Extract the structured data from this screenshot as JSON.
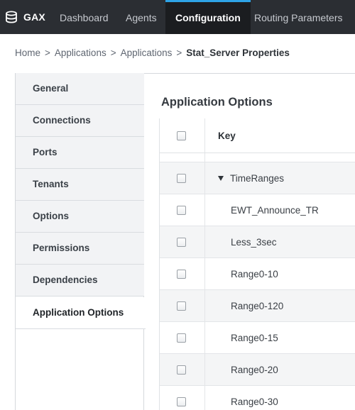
{
  "topbar": {
    "brand": {
      "label": "GAX",
      "icon": "database-icon"
    },
    "tabs": [
      {
        "label": "Dashboard",
        "active": false
      },
      {
        "label": "Agents",
        "active": false
      },
      {
        "label": "Configuration",
        "active": true
      },
      {
        "label": "Routing Parameters",
        "active": false
      }
    ],
    "colors": {
      "background": "#2b2e33",
      "active_background": "#1b1d20",
      "accent": "#2ea3e6"
    }
  },
  "breadcrumb": {
    "items": [
      "Home",
      "Applications",
      "Applications"
    ],
    "separator": ">",
    "current": "Stat_Server Properties"
  },
  "sidenav": {
    "items": [
      {
        "label": "General",
        "active": false
      },
      {
        "label": "Connections",
        "active": false
      },
      {
        "label": "Ports",
        "active": false
      },
      {
        "label": "Tenants",
        "active": false
      },
      {
        "label": "Options",
        "active": false
      },
      {
        "label": "Permissions",
        "active": false
      },
      {
        "label": "Dependencies",
        "active": false
      },
      {
        "label": "Application Options",
        "active": true
      }
    ]
  },
  "main": {
    "title": "Application Options",
    "table": {
      "columns": [
        "Key"
      ],
      "group": {
        "label": "TimeRanges",
        "expanded": true,
        "expand_icon": "caret-down-icon"
      },
      "rows": [
        "EWT_Announce_TR",
        "Less_3sec",
        "Range0-10",
        "Range0-120",
        "Range0-15",
        "Range0-20",
        "Range0-30"
      ]
    }
  }
}
